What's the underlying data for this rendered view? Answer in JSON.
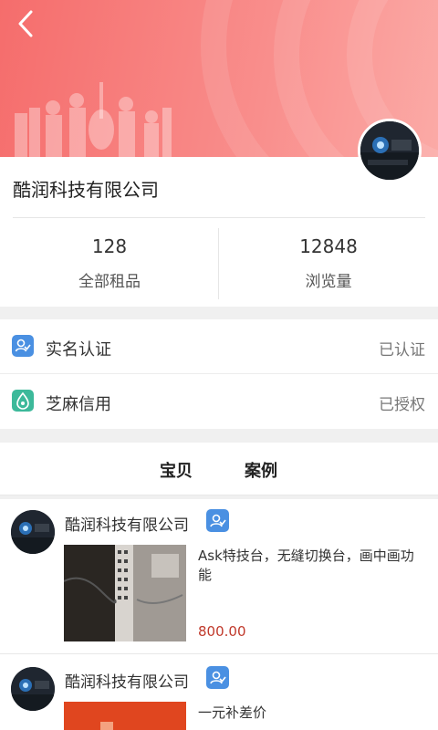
{
  "header": {
    "back_icon": "chevron-left-icon"
  },
  "company": {
    "name": "酷润科技有限公司",
    "stats": [
      {
        "value": "128",
        "label": "全部租品"
      },
      {
        "value": "12848",
        "label": "浏览量"
      }
    ]
  },
  "verifications": [
    {
      "label": "实名认证",
      "status": "已认证",
      "icon": "user-verify-icon",
      "color": "#4a90e2"
    },
    {
      "label": "芝麻信用",
      "status": "已授权",
      "icon": "sesame-credit-icon",
      "color": "#3cb99a"
    }
  ],
  "tabs": [
    {
      "label": "宝贝"
    },
    {
      "label": "案例"
    }
  ],
  "posts": [
    {
      "author": "酷润科技有限公司",
      "title": "Ask特技台，无缝切换台，画中画功能",
      "price": "800.00"
    },
    {
      "author": "酷润科技有限公司",
      "title": "一元补差价",
      "price": ""
    }
  ],
  "colors": {
    "header_start": "#f56d6c",
    "price": "#c0392b",
    "badge": "#4a90e2"
  }
}
